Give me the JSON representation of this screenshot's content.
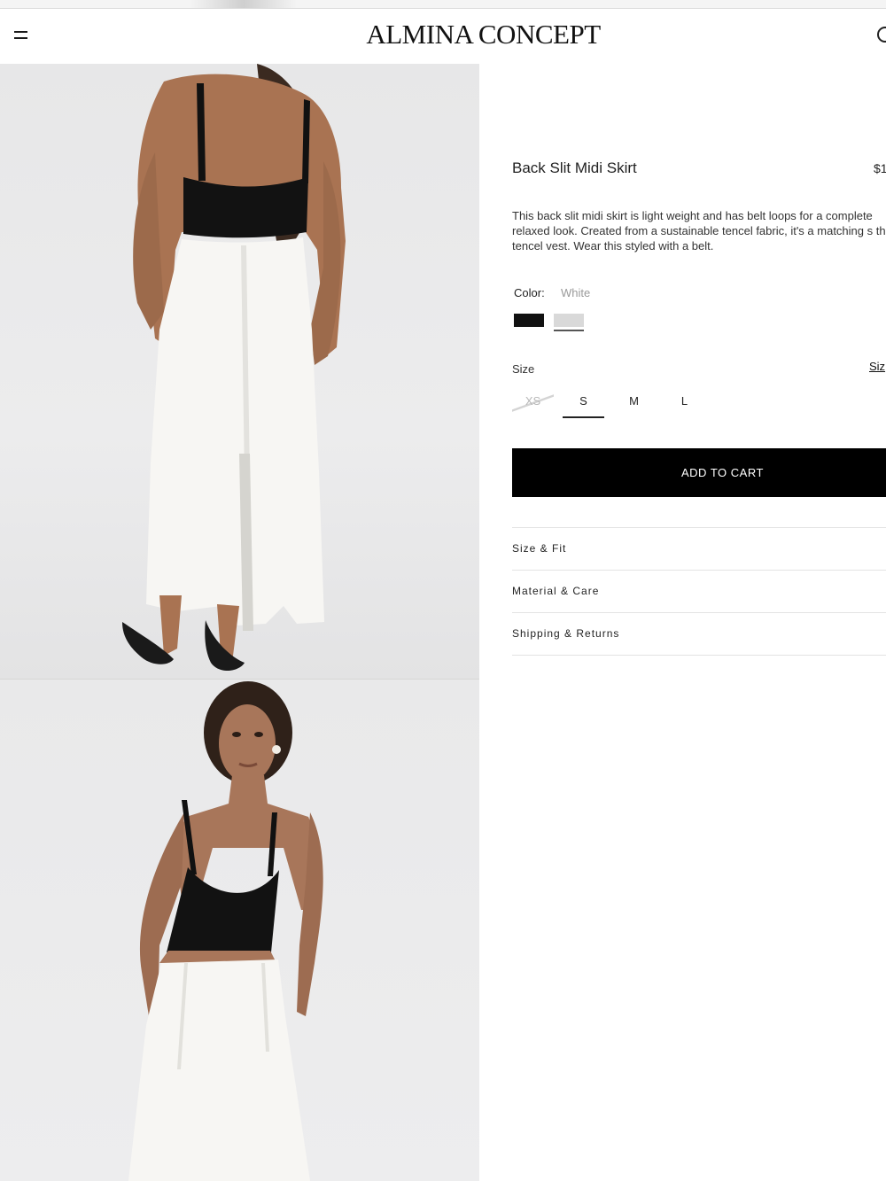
{
  "brand": {
    "logo": "ALMINA CONCEPT"
  },
  "header": {
    "menu_icon": "hamburger-menu-icon",
    "account_icon": "account-icon"
  },
  "gallery": {
    "images": [
      {
        "alt": "Model back view in black knit top and white back slit midi skirt"
      },
      {
        "alt": "Model front view in black knit top and white midi skirt"
      }
    ]
  },
  "product": {
    "title": "Back Slit Midi Skirt",
    "price": "$1",
    "description": "This back slit midi skirt is light weight and has belt loops for a complete relaxed look. Created from a sustainable tencel fabric, it's a matching s the tencel vest. Wear this styled with a belt.",
    "color_label": "Color:",
    "color_value": "White",
    "colors": [
      {
        "name": "Black",
        "hex": "#111111"
      },
      {
        "name": "White",
        "hex": "#d9d9d9",
        "selected": true
      }
    ],
    "size_label": "Size",
    "size_guide": "Siz",
    "sizes": [
      "XS",
      "S",
      "M",
      "L"
    ],
    "selected_size": "S",
    "add_to_cart": "ADD TO CART"
  },
  "accordion": [
    "Size & Fit",
    "Material & Care",
    "Shipping & Returns"
  ]
}
